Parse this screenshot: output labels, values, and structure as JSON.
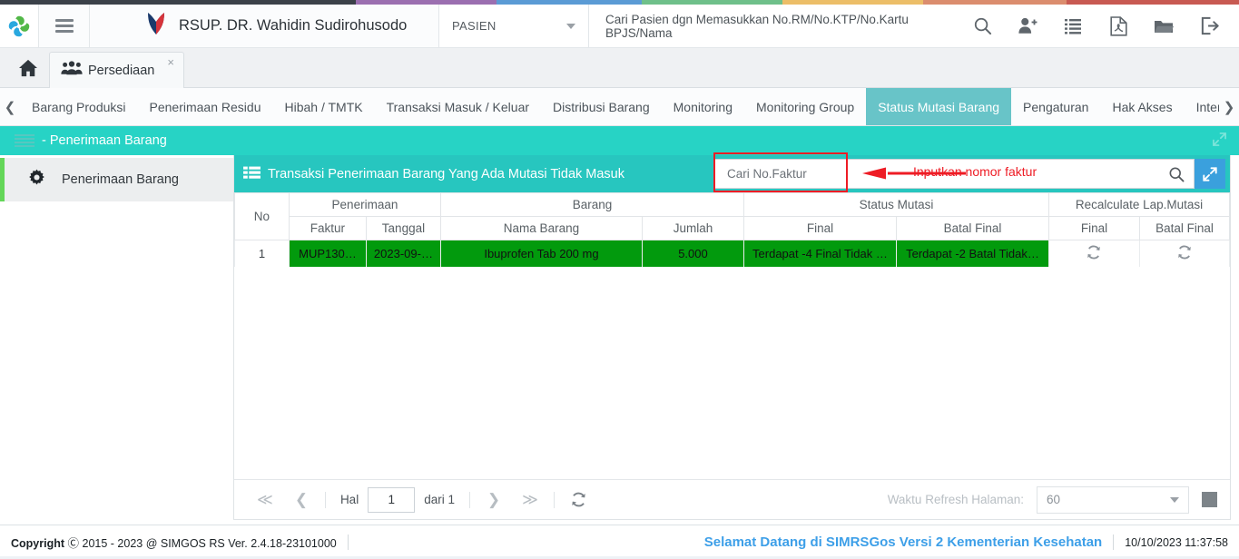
{
  "colorstrip": [
    "#3b4149",
    "#9b6fb0",
    "#5b9bd5",
    "#6fc08a",
    "#ecbe68",
    "#db8d6e",
    "#c85a52"
  ],
  "header": {
    "logo_icon": "simgos-pinwheel-logo",
    "burger_icon": "hamburger-menu-icon",
    "brand_icon": "hospital-flame-icon",
    "brand_title": "RSUP. DR. Wahidin Sudirohusodo",
    "select_value": "PASIEN",
    "search_placeholder": "Cari Pasien dgn Memasukkan No.RM/No.KTP/No.Kartu BPJS/Nama",
    "icons": [
      {
        "name": "search-icon",
        "label": "Cari"
      },
      {
        "name": "add-user-icon",
        "label": "Tambah Pasien"
      },
      {
        "name": "list-icon",
        "label": "Daftar"
      },
      {
        "name": "pdf-file-icon",
        "label": "Laporan PDF"
      },
      {
        "name": "folder-icon",
        "label": "Arsip"
      },
      {
        "name": "logout-icon",
        "label": "Keluar"
      }
    ]
  },
  "tabs": {
    "home_icon": "home-icon",
    "items": [
      {
        "label": "Persediaan",
        "icon": "users-group-icon",
        "close": "×",
        "active": true
      }
    ]
  },
  "modnav": {
    "prev_icon": "chevron-left-icon",
    "next_icon": "chevron-right-icon",
    "items": [
      {
        "label": "Barang Produksi",
        "active": false
      },
      {
        "label": "Penerimaan Residu",
        "active": false
      },
      {
        "label": "Hibah / TMTK",
        "active": false
      },
      {
        "label": "Transaksi Masuk / Keluar",
        "active": false
      },
      {
        "label": "Distribusi Barang",
        "active": false
      },
      {
        "label": "Monitoring",
        "active": false
      },
      {
        "label": "Monitoring Group",
        "active": false
      },
      {
        "label": "Status Mutasi Barang",
        "active": true
      },
      {
        "label": "Pengaturan",
        "active": false
      },
      {
        "label": "Hak Akses",
        "active": false
      },
      {
        "label": "Interkoneksi SAKTI",
        "active": false
      }
    ]
  },
  "banner": {
    "grip_icon": "drag-grip-icon",
    "title": "- Penerimaan Barang",
    "expand_icon": "expand-arrows-icon"
  },
  "sidebar": {
    "items": [
      {
        "label": "Penerimaan Barang",
        "icon": "gear-icon",
        "active": true
      }
    ]
  },
  "panel": {
    "head_icon": "table-list-icon",
    "title": "Transaksi Penerimaan Barang Yang Ada Mutasi Tidak Masuk",
    "search_placeholder": "Cari No.Faktur",
    "search_value": "",
    "search_icon": "search-icon",
    "expand_icon": "expand-diagonal-icon"
  },
  "annotation": {
    "text": "Inputkan nomor faktur",
    "color": "#ee1c25"
  },
  "table": {
    "group_headers": [
      {
        "label": "No",
        "rowspan": 2
      },
      {
        "label": "Penerimaan",
        "colspan": 2
      },
      {
        "label": "Barang",
        "colspan": 2
      },
      {
        "label": "Status Mutasi",
        "colspan": 2
      },
      {
        "label": "Recalculate Lap.Mutasi",
        "colspan": 2
      }
    ],
    "sub_headers": [
      "Faktur",
      "Tanggal",
      "Nama Barang",
      "Jumlah",
      "Final",
      "Batal Final",
      "Final",
      "Batal Final"
    ],
    "rows": [
      {
        "no": "1",
        "faktur": "MUP130…",
        "tanggal": "2023-09-…",
        "nama_barang": "Ibuprofen Tab 200 mg",
        "jumlah": "5.000",
        "status_final": "Terdapat -4 Final Tidak …",
        "status_batal_final": "Terdapat -2 Batal Tidak…",
        "recalc_final_icon": "refresh-icon",
        "recalc_batal_icon": "refresh-icon",
        "highlight_color": "#029a0d"
      }
    ]
  },
  "pager": {
    "first_icon": "double-chevron-left-icon",
    "prev_icon": "chevron-left-icon",
    "page_label": "Hal",
    "page_value": "1",
    "of_label": "dari 1",
    "next_icon": "chevron-right-icon",
    "last_icon": "double-chevron-right-icon",
    "refresh_icon": "refresh-icon",
    "refresh_label": "Waktu Refresh Halaman:",
    "refresh_value": "60",
    "stop_icon": "stop-square-icon"
  },
  "footer": {
    "copyright_bold": "Copyright",
    "copyright_icon": "copyright-icon",
    "copyright_text": "2015 - 2023 @ SIMGOS RS Ver. 2.4.18-23101000",
    "welcome": "Selamat Datang di SIMRSGos Versi 2 Kementerian Kesehatan",
    "datetime": "10/10/2023 11:37:58"
  }
}
